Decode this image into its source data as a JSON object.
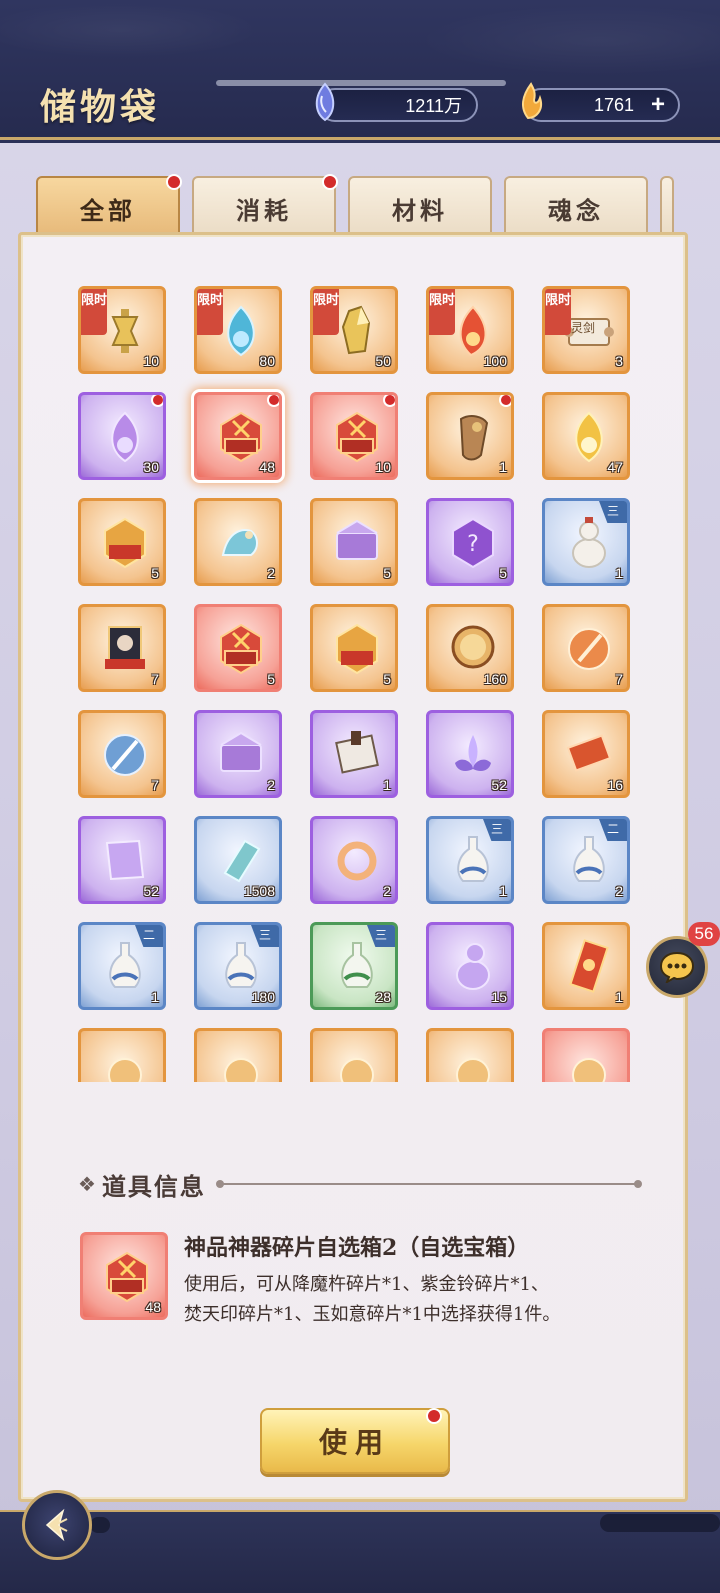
{
  "header": {
    "title": "储物袋",
    "currency_spirit": "1211万",
    "currency_gold": "1761",
    "add_label": "+"
  },
  "tabs": [
    {
      "label": "全部",
      "active": true,
      "dot": true
    },
    {
      "label": "消耗",
      "active": false,
      "dot": true
    },
    {
      "label": "材料",
      "active": false,
      "dot": false
    },
    {
      "label": "魂念",
      "active": false,
      "dot": false
    }
  ],
  "items": [
    {
      "count": "10",
      "rarity": "orange",
      "limited": "限时",
      "art": "banner"
    },
    {
      "count": "80",
      "rarity": "orange",
      "limited": "限时",
      "art": "flame-blue"
    },
    {
      "count": "50",
      "rarity": "orange",
      "limited": "限时",
      "art": "crystal-gold"
    },
    {
      "count": "100",
      "rarity": "orange",
      "limited": "限时",
      "art": "flame-red"
    },
    {
      "count": "3",
      "rarity": "orange",
      "limited": "限时",
      "art": "scroll",
      "scroll_text": "灵剑"
    },
    {
      "count": "30",
      "rarity": "purple",
      "dot": true,
      "art": "flame-purple"
    },
    {
      "count": "48",
      "rarity": "red",
      "dot": true,
      "art": "chest-red",
      "selected": true
    },
    {
      "count": "10",
      "rarity": "red",
      "dot": true,
      "art": "chest-red"
    },
    {
      "count": "1",
      "rarity": "orange",
      "dot": true,
      "art": "pouch"
    },
    {
      "count": "47",
      "rarity": "orange",
      "art": "flame-gold"
    },
    {
      "count": "5",
      "rarity": "orange",
      "art": "chest-gold"
    },
    {
      "count": "2",
      "rarity": "orange",
      "art": "slipper"
    },
    {
      "count": "5",
      "rarity": "orange",
      "art": "chest-purple"
    },
    {
      "count": "5",
      "rarity": "purple",
      "art": "mystery"
    },
    {
      "count": "1",
      "rarity": "blue",
      "tier": "三",
      "art": "gourd"
    },
    {
      "count": "7",
      "rarity": "orange",
      "art": "portrait"
    },
    {
      "count": "5",
      "rarity": "red",
      "art": "chest-red"
    },
    {
      "count": "5",
      "rarity": "orange",
      "art": "chest-gold"
    },
    {
      "count": "160",
      "rarity": "orange",
      "art": "mirror"
    },
    {
      "count": "7",
      "rarity": "orange",
      "art": "sword-emblem"
    },
    {
      "count": "7",
      "rarity": "orange",
      "art": "sword-blue"
    },
    {
      "count": "2",
      "rarity": "purple",
      "art": "chest-purple"
    },
    {
      "count": "1",
      "rarity": "purple",
      "art": "letter"
    },
    {
      "count": "52",
      "rarity": "purple",
      "art": "lotus"
    },
    {
      "count": "16",
      "rarity": "orange",
      "art": "scroll-red"
    },
    {
      "count": "52",
      "rarity": "purple",
      "art": "cloth"
    },
    {
      "count": "1508",
      "rarity": "blue",
      "art": "scroll-blue"
    },
    {
      "count": "2",
      "rarity": "purple",
      "art": "ring"
    },
    {
      "count": "1",
      "rarity": "blue",
      "tier": "三",
      "art": "vase"
    },
    {
      "count": "2",
      "rarity": "blue",
      "tier": "二",
      "art": "vase"
    },
    {
      "count": "1",
      "rarity": "blue",
      "tier": "二",
      "art": "vase"
    },
    {
      "count": "180",
      "rarity": "blue",
      "tier": "三",
      "art": "vase"
    },
    {
      "count": "28",
      "rarity": "green",
      "tier": "三",
      "art": "vase-green"
    },
    {
      "count": "15",
      "rarity": "purple",
      "art": "gourd-purple"
    },
    {
      "count": "1",
      "rarity": "orange",
      "art": "talisman"
    },
    {
      "count": "",
      "rarity": "orange",
      "art": "misc"
    },
    {
      "count": "",
      "rarity": "orange",
      "art": "misc"
    },
    {
      "count": "",
      "rarity": "orange",
      "art": "misc"
    },
    {
      "count": "",
      "rarity": "orange",
      "art": "misc"
    },
    {
      "count": "",
      "rarity": "red",
      "art": "misc"
    }
  ],
  "info": {
    "section_label": "道具信息",
    "item_count": "48",
    "item_name": "神品神器碎片自选箱2（自选宝箱）",
    "description_line1": "使用后，可从降魔杵碎片*1、紫金铃碎片*1、",
    "description_line2": "焚天印碎片*1、玉如意碎片*1中选择获得1件。"
  },
  "use_button": {
    "label": "使用"
  },
  "chat": {
    "badge": "56"
  },
  "colors": {
    "orange_frame": "#e3953e",
    "purple_frame": "#9d5fe0",
    "red_frame": "#f07f74",
    "blue_frame": "#5b86c6",
    "green_frame": "#4c9a58",
    "red_dot": "#d32b2b",
    "gold_accent": "#c9a86a"
  }
}
